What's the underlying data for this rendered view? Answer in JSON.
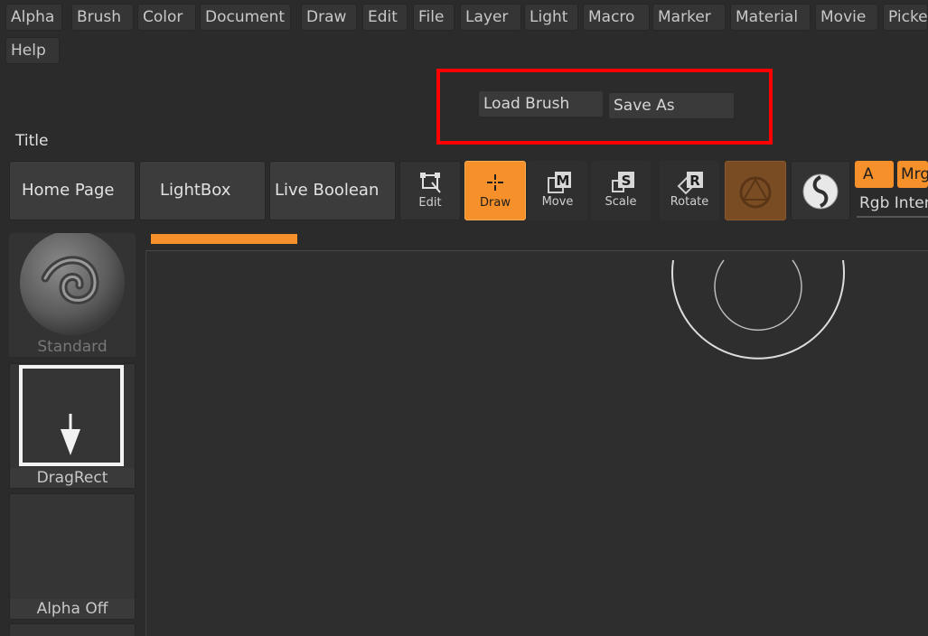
{
  "menu": {
    "items": [
      "Alpha",
      "Brush",
      "Color",
      "Document",
      "Draw",
      "Edit",
      "File",
      "Layer",
      "Light",
      "Macro",
      "Marker",
      "Material",
      "Movie",
      "Picker"
    ],
    "help": "Help"
  },
  "brush_panel": {
    "load_label": "Load Brush",
    "save_label": "Save As"
  },
  "title_label": "Title",
  "shelf": {
    "home": "Home Page",
    "lightbox": "LightBox",
    "live_boolean": "Live Boolean"
  },
  "tools": {
    "edit": "Edit",
    "draw": "Draw",
    "move": "Move",
    "scale": "Scale",
    "rotate": "Rotate"
  },
  "tool_glyphs": {
    "move": "M",
    "scale": "S",
    "rotate": "R"
  },
  "right_top": {
    "a_label": "A",
    "mrg_label": "Mrg",
    "rgb_label": "Rgb Intensity"
  },
  "left_shelf": {
    "brush": "Standard",
    "stroke": "DragRect",
    "alpha": "Alpha Off"
  },
  "colors": {
    "accent": "#f6902b",
    "highlight": "#ff0000",
    "background": "#2b2b2b"
  }
}
